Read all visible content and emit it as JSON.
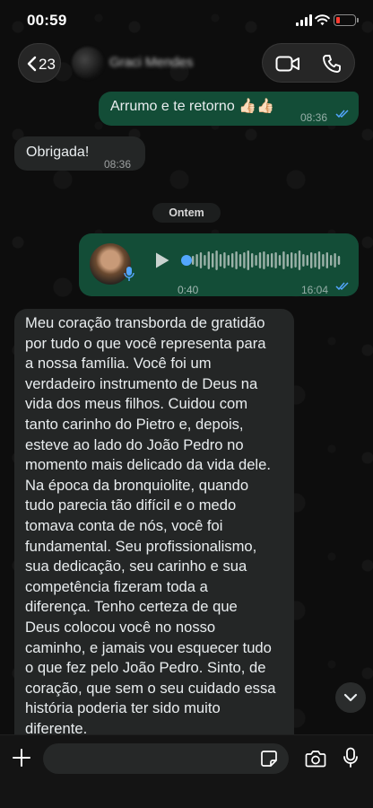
{
  "status": {
    "time": "00:59"
  },
  "header": {
    "back_count": "23",
    "contact_name": "Graci Mendes"
  },
  "messages": [
    {
      "direction": "out",
      "text": "Arrumo e te retorno 👍🏻👍🏻",
      "time": "08:36",
      "read": true
    },
    {
      "direction": "in",
      "text": "Obrigada!",
      "time": "08:36"
    }
  ],
  "day_separator": "Ontem",
  "voice_message": {
    "direction": "out",
    "duration": "0:40",
    "time": "16:04",
    "read": true
  },
  "long_message": {
    "direction": "in",
    "lines": [
      "Meu coração transborda de gratidão",
      "por tudo o que você representa para",
      "a nossa família. Você foi um",
      "verdadeiro instrumento de Deus na",
      "vida dos meus filhos. Cuidou com",
      "tanto carinho do Pietro e, depois,",
      "esteve ao lado do João Pedro no",
      "momento mais delicado da vida dele.",
      "Na época da bronquiolite, quando",
      "tudo parecia tão difícil e o medo",
      "tomava conta de nós, você foi",
      "fundamental. Seu profissionalismo,",
      "sua dedicação, seu carinho e sua",
      "competência fizeram toda a",
      "diferença. Tenho certeza de que",
      "Deus colocou você no nosso",
      "caminho, e jamais vou esquecer tudo",
      "o que fez pelo João Pedro. Sinto, de",
      "coração, que sem o seu cuidado essa",
      "história poderia ter sido muito",
      "diferente."
    ]
  },
  "composer": {
    "placeholder": ""
  },
  "colors": {
    "outgoing_bubble": "#134d37",
    "incoming_bubble": "#242626",
    "read_ticks": "#53a6fd",
    "battery_low": "#ff3b30"
  },
  "icons": [
    "back-chevron-icon",
    "video-call-icon",
    "phone-call-icon",
    "play-icon",
    "microphone-icon",
    "plus-icon",
    "sticker-icon",
    "camera-icon",
    "chevron-down-icon"
  ]
}
